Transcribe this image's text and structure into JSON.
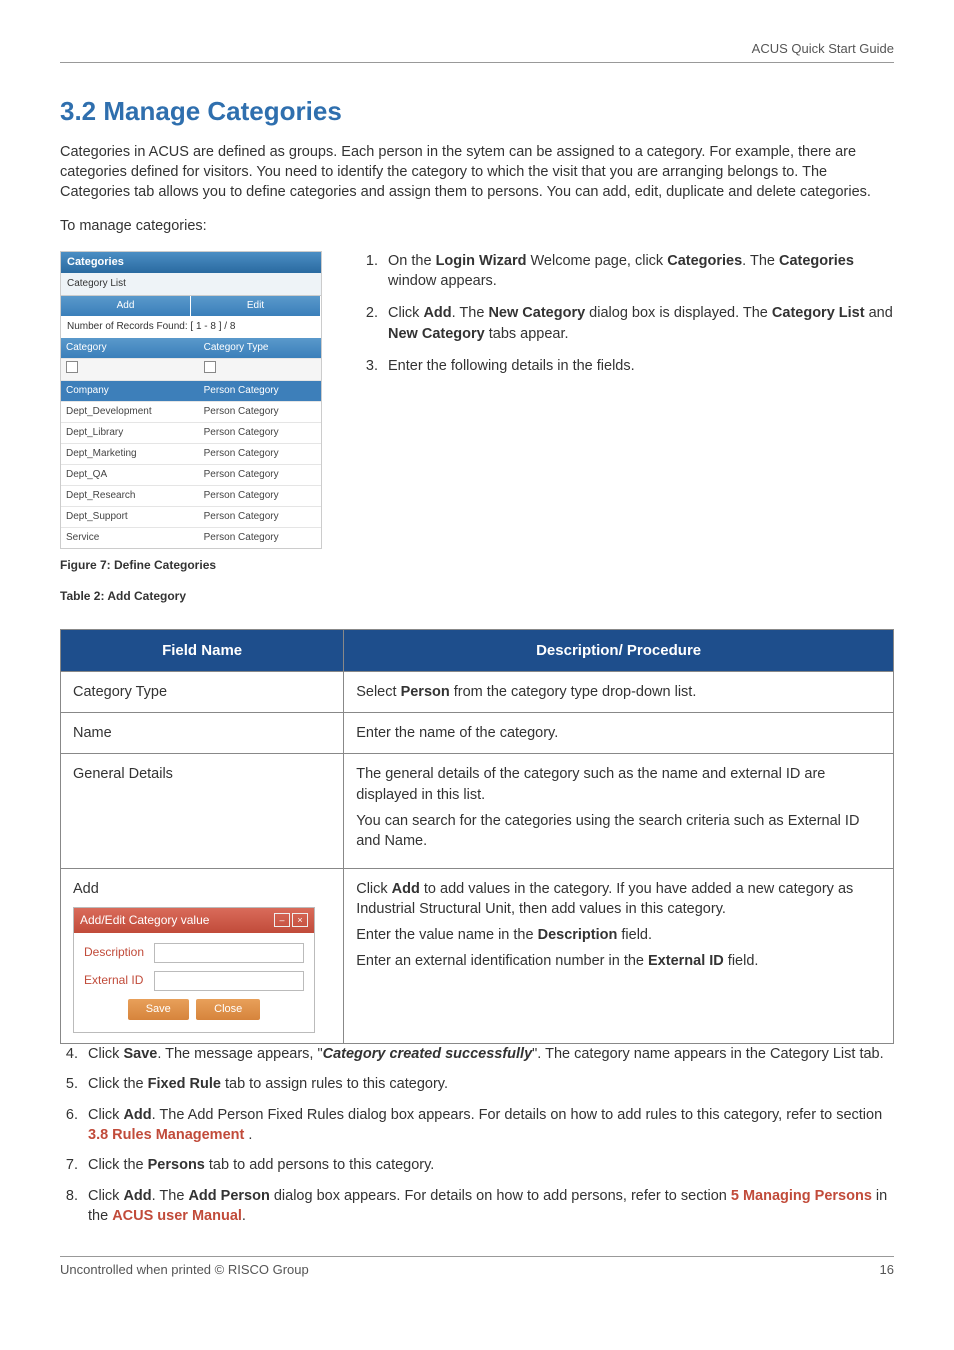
{
  "header": {
    "doc_title": "ACUS Quick Start Guide"
  },
  "section": {
    "number_title": "3.2  Manage Categories",
    "intro": "Categories in ACUS are defined as groups. Each person in the sytem can be assigned to a category. For example, there are categories defined for visitors. You need to identify the category to which the visit that you are arranging belongs to. The Categories tab allows you to define categories and assign them to persons. You can add, edit, duplicate and delete categories.",
    "lead": "To manage categories:"
  },
  "screenshot": {
    "window_title": "Categories",
    "tab": "Category List",
    "toolbar": [
      "Add",
      "Edit"
    ],
    "records_label": "Number of Records Found: [ 1 - 8 ]  / 8",
    "columns": [
      "Category",
      "Category Type"
    ],
    "rows": [
      {
        "c1": "Company",
        "c2": "Person Category",
        "selected": true
      },
      {
        "c1": "Dept_Development",
        "c2": "Person Category"
      },
      {
        "c1": "Dept_Library",
        "c2": "Person Category"
      },
      {
        "c1": "Dept_Marketing",
        "c2": "Person Category"
      },
      {
        "c1": "Dept_QA",
        "c2": "Person Category"
      },
      {
        "c1": "Dept_Research",
        "c2": "Person Category"
      },
      {
        "c1": "Dept_Support",
        "c2": "Person Category"
      },
      {
        "c1": "Service",
        "c2": "Person Category"
      }
    ]
  },
  "captions": {
    "figure": "Figure 7: Define Categories",
    "table": "Table 2: Add Category"
  },
  "steps_a": {
    "s1a": "On the ",
    "s1b": "Login Wizard",
    "s1c": " Welcome page, click ",
    "s1d": "Categories",
    "s1e": ". The ",
    "s1f": "Categories",
    "s1g": " window appears.",
    "s2a": "Click ",
    "s2b": "Add",
    "s2c": ". The ",
    "s2d": "New Category",
    "s2e": " dialog box is displayed. The ",
    "s2f": "Category List",
    "s2g": " and ",
    "s2h": "New Category",
    "s2i": " tabs appear.",
    "s3": "Enter the following details in the fields."
  },
  "table": {
    "head1": "Field Name",
    "head2": "Description/ Procedure",
    "r1c1": "Category Type",
    "r1c2a": "Select ",
    "r1c2b": "Person",
    "r1c2c": " from the category type drop-down list.",
    "r2c1": "Name",
    "r2c2": "Enter the name of the category.",
    "r3c1": "General Details",
    "r3c2a": "The general details of the category such as the name and external ID are displayed in this list.",
    "r3c2b": "You can search for the categories using the search criteria such as External ID and Name.",
    "r4c1": "Add",
    "r4c2a": "Click ",
    "r4c2b": "Add",
    "r4c2c": " to add values in the category. If you have added a new category as Industrial Structural Unit, then add values in this category.",
    "r4c2d": "Enter the value name in the ",
    "r4c2e": "Description",
    "r4c2f": " field.",
    "r4c2g": "Enter an external identification number in the ",
    "r4c2h": "External ID",
    "r4c2i": " field."
  },
  "addedit_panel": {
    "title": "Add/Edit Category value",
    "lbl_desc": "Description",
    "lbl_ext": "External ID",
    "btn_save": "Save",
    "btn_close": "Close"
  },
  "steps_b": {
    "s4a": "Click ",
    "s4b": "Save",
    "s4c": ". The message appears, \"",
    "s4d": "Category created successfully",
    "s4e": "\". The category name appears in the Category List tab.",
    "s5a": "Click the ",
    "s5b": "Fixed Rule",
    "s5c": " tab to assign rules to this category.",
    "s6a": "Click ",
    "s6b": "Add",
    "s6c": ". The Add Person Fixed Rules dialog box appears. For details on how to add rules to this category, refer to section ",
    "s6d": "3.8 Rules Management",
    "s6e": " .",
    "s7a": "Click the ",
    "s7b": "Persons",
    "s7c": " tab to add persons to this category.",
    "s8a": "Click ",
    "s8b": "Add",
    "s8c": ". The ",
    "s8d": "Add Person",
    "s8e": " dialog box appears. For details on how to add persons, refer to section ",
    "s8f": "5 Managing Persons",
    "s8g": " in the ",
    "s8h": "ACUS user Manual",
    "s8i": "."
  },
  "footer": {
    "left": "Uncontrolled when printed © RISCO Group",
    "right": "16"
  }
}
